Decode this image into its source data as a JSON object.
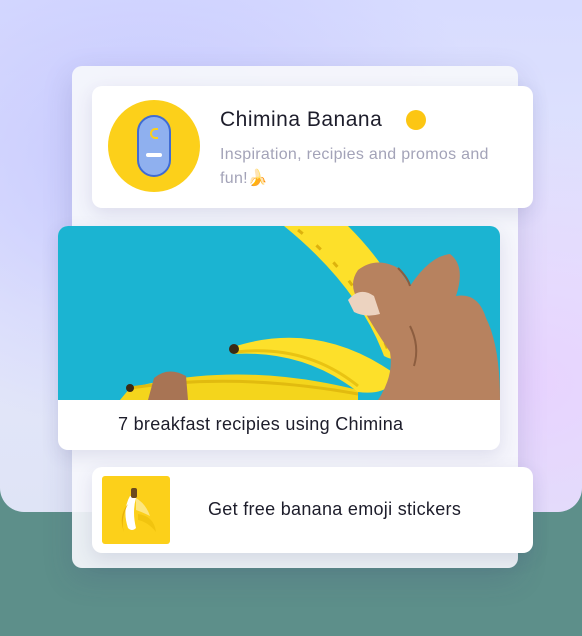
{
  "profile": {
    "name": "Chimina Banana",
    "bio": "Inspiration, recipies and promos and fun!🍌",
    "verified_color": "#fcc613",
    "avatar_icon": "banana-pill-logo-icon"
  },
  "post": {
    "title": "7 breakfast recipies using Chimina",
    "image": "hand-holding-bananas-photo"
  },
  "sticker_promo": {
    "label": "Get free banana emoji stickers",
    "thumb_icon": "peeled-banana-icon"
  },
  "colors": {
    "brand_yellow": "#fcd01a",
    "photo_background": "#1bb4d2",
    "accent_blue": "#3f6cd4"
  }
}
